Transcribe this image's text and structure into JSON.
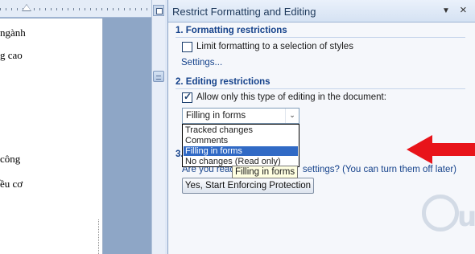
{
  "document": {
    "lines": [
      "ngành",
      "g cao",
      "công",
      "ều cơ"
    ]
  },
  "pane": {
    "title": "Restrict Formatting and Editing",
    "section1": {
      "heading": "1. Formatting restrictions",
      "checkbox_label": "Limit formatting to a selection of styles",
      "checkbox_checked": false,
      "settings_link": "Settings..."
    },
    "section2": {
      "heading": "2. Editing restrictions",
      "checkbox_label": "Allow only this type of editing in the document:",
      "checkbox_checked": true,
      "combo_value": "Filling in forms",
      "options": [
        "Tracked changes",
        "Comments",
        "Filling in forms",
        "No changes (Read only)"
      ],
      "selected_option": "Filling in forms"
    },
    "section3": {
      "heading_visible": "3.",
      "question_start": "Are you read",
      "question_end": "settings? (You can turn them off later)",
      "enforce_button": "Yes, Start Enforcing Protection"
    },
    "tooltip": "Filling in forms"
  },
  "annotation": {
    "arrow_color": "#e8141a"
  },
  "watermark": {
    "text": "uantrimang"
  }
}
